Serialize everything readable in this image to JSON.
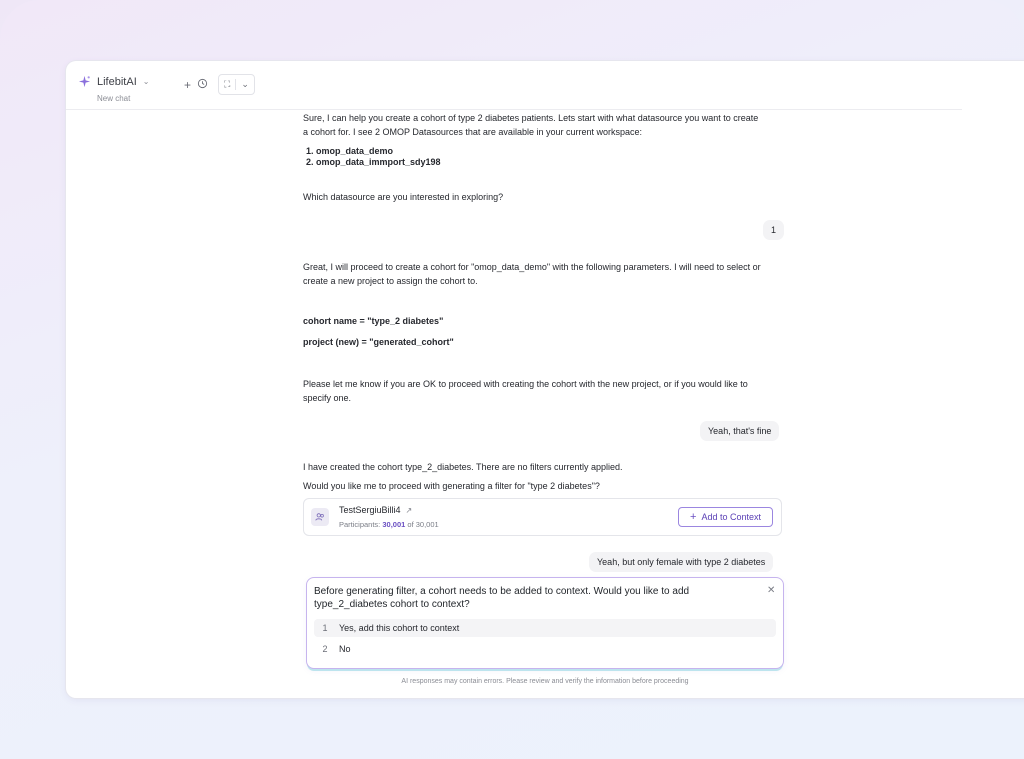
{
  "header": {
    "app_name": "LifebitAI",
    "subtitle": "New chat",
    "icons": {
      "logo": "sparkle-icon",
      "menu": "chevron-down-icon",
      "new": "plus-icon",
      "history": "history-icon",
      "expand": "expand-icon",
      "expand_menu": "chevron-down-icon"
    }
  },
  "chat": {
    "msg1_line1": "Sure, I can help you create a cohort of type 2 diabetes patients. Lets start with what datasource you want to create",
    "msg1_line2": "a cohort for. I see 2 OMOP Datasources that are available in your current workspace:",
    "datasources": [
      "omop_data_demo",
      "omop_data_immport_sdy198"
    ],
    "msg1_question": "Which datasource are you interested in exploring?",
    "user1": "1",
    "msg2_line1": "Great, I will proceed to create a cohort for \"omop_data_demo\" with the following parameters. I will need to select or",
    "msg2_line2": "create a new project to assign the cohort to.",
    "param_cohort": "cohort name = \"type_2 diabetes\"",
    "param_project": "project (new) = \"generated_cohort\"",
    "msg3_line1": "Please let me know if you are OK to proceed with creating the cohort with the new project, or if you would like to",
    "msg3_line2": "specify one.",
    "user2": "Yeah, that's fine",
    "msg4_line1": "I have created the cohort type_2_diabetes. There are no filters currently applied.",
    "msg4_line2": "Would you like me to proceed with generating a filter for \"type 2 diabetes\"?",
    "user3": "Yeah, but only female with type 2 diabetes"
  },
  "cohort_card": {
    "name": "TestSergiuBilli4",
    "participants_label": "Participants:",
    "participants_count": "30,001",
    "of_text": "of 30,001",
    "add_button": "Add to Context",
    "icons": {
      "avatar": "users-icon",
      "external": "external-link-icon",
      "add": "plus-icon"
    }
  },
  "prompt": {
    "question": "Before generating filter, a cohort needs to be added to context. Would you like to add type_2_diabetes cohort to context?",
    "options": [
      {
        "num": "1",
        "label": "Yes, add this cohort to context"
      },
      {
        "num": "2",
        "label": "No"
      }
    ],
    "close_icon": "close-icon"
  },
  "disclaimer": "AI responses may contain errors. Please review and verify the information before proceeding",
  "colors": {
    "accent": "#6a4fc2",
    "accent_border": "#9b86e0",
    "prompt_border": "#c6b4ee",
    "bubble_bg": "#f3f3f5"
  }
}
